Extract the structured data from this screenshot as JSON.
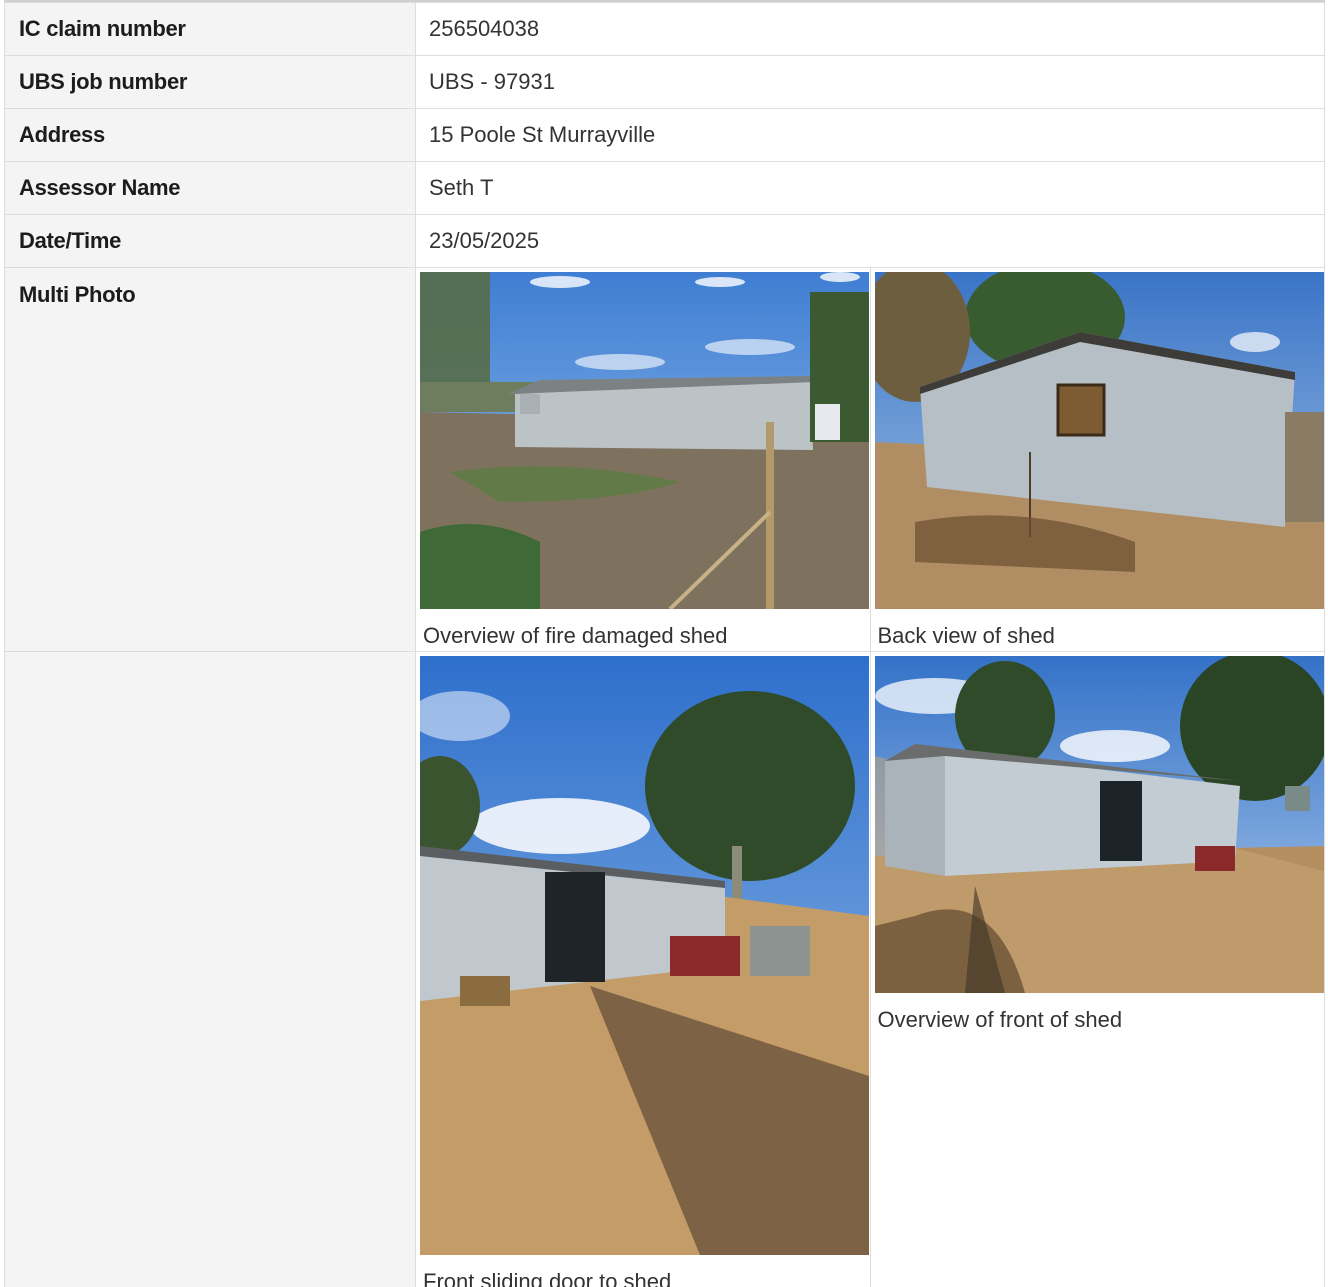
{
  "fields": [
    {
      "label": "IC claim number",
      "value": "256504038"
    },
    {
      "label": "UBS job number",
      "value": "UBS - 97931"
    },
    {
      "label": "Address",
      "value": "15 Poole St Murrayville"
    },
    {
      "label": "Assessor Name",
      "value": "Seth T"
    },
    {
      "label": "Date/Time",
      "value": "23/05/2025"
    }
  ],
  "multi_photo": {
    "label": "Multi Photo",
    "photos": [
      {
        "caption": "Overview of fire damaged shed",
        "subject": "shed-side-view-photo"
      },
      {
        "caption": "Back view of shed",
        "subject": "shed-back-view-photo"
      },
      {
        "caption": "Front sliding door to shed",
        "subject": "shed-front-door-photo"
      },
      {
        "caption": "Overview of front of shed",
        "subject": "shed-front-overview-photo"
      }
    ]
  }
}
